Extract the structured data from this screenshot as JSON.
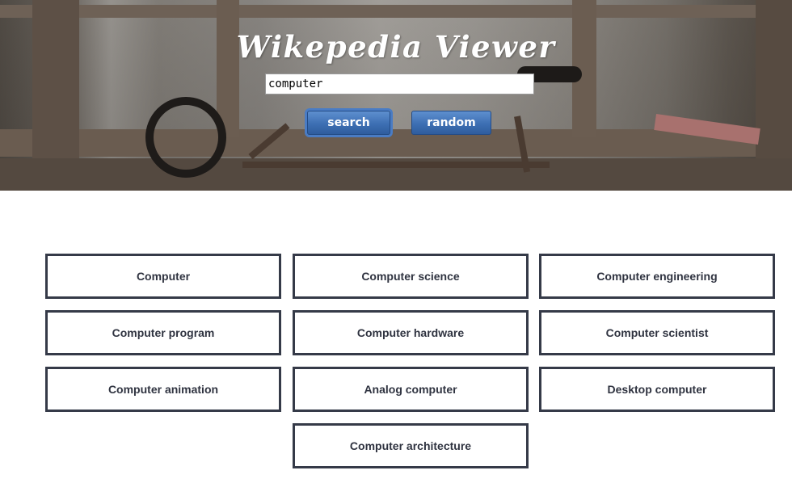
{
  "header": {
    "title": "Wikepedia Viewer"
  },
  "search": {
    "value": "computer",
    "search_label": "search",
    "random_label": "random"
  },
  "results": [
    {
      "title": "Computer"
    },
    {
      "title": "Computer science"
    },
    {
      "title": "Computer engineering"
    },
    {
      "title": "Computer program"
    },
    {
      "title": "Computer hardware"
    },
    {
      "title": "Computer scientist"
    },
    {
      "title": "Computer animation"
    },
    {
      "title": "Analog computer"
    },
    {
      "title": "Desktop computer"
    },
    {
      "title": "Computer architecture"
    }
  ],
  "colors": {
    "button": "#3d6fb3",
    "result_border": "#353a48",
    "result_text": "#2f3340"
  }
}
